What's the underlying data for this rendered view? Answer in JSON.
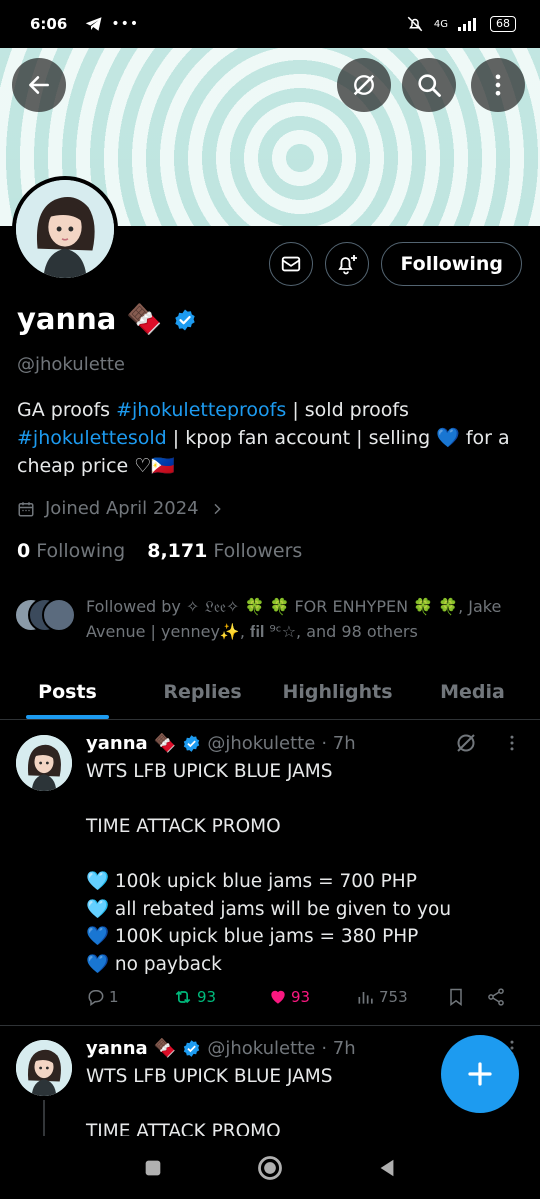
{
  "status_bar": {
    "time": "6:06",
    "network": "4G",
    "battery": "68"
  },
  "profile": {
    "display_name": "yanna 🍫",
    "handle": "@jhokulette",
    "bio": {
      "part1": "GA proofs ",
      "tag1": "#jhokuletteproofs",
      "part2": " | sold proofs ",
      "tag2": "#jhokulettesold",
      "part3": " | kpop fan account | selling 💙 for a cheap price ♡🇵🇭"
    },
    "joined": "Joined April 2024",
    "following_count": "0",
    "following_label": "Following",
    "followers_count": "8,171",
    "followers_label": "Followers",
    "followed_by": "Followed by ✧ 𝔏𝔢𝔢✧ 🍀 🍀 FOR ENHYPEN 🍀 🍀, Jake Avenue | yenney✨, 𝐟𝐢𝐥 ⁹ᶜ☆, and 98 others",
    "following_button": "Following"
  },
  "tabs": [
    {
      "label": "Posts",
      "active": true
    },
    {
      "label": "Replies",
      "active": false
    },
    {
      "label": "Highlights",
      "active": false
    },
    {
      "label": "Media",
      "active": false
    }
  ],
  "posts": [
    {
      "name": "yanna 🍫",
      "handle": "@jhokulette",
      "time": "· 7h",
      "body": "WTS LFB UPICK BLUE JAMS\n\nTIME ATTACK PROMO\n\n🩵 100k upick blue jams = 700 PHP\n🩵 all rebated jams will be given to you\n💙 100K upick blue jams = 380 PHP\n💙 no payback",
      "replies": "1",
      "reposts": "93",
      "likes": "93",
      "views": "753"
    },
    {
      "name": "yanna 🍫",
      "handle": "@jhokulette",
      "time": "· 7h",
      "body": "WTS LFB UPICK BLUE JAMS\n\nTIME ATTACK PROMO"
    }
  ],
  "colors": {
    "accent": "#1d9bf0",
    "repost": "#00ba7c",
    "like": "#f91880",
    "muted": "#71767b"
  }
}
